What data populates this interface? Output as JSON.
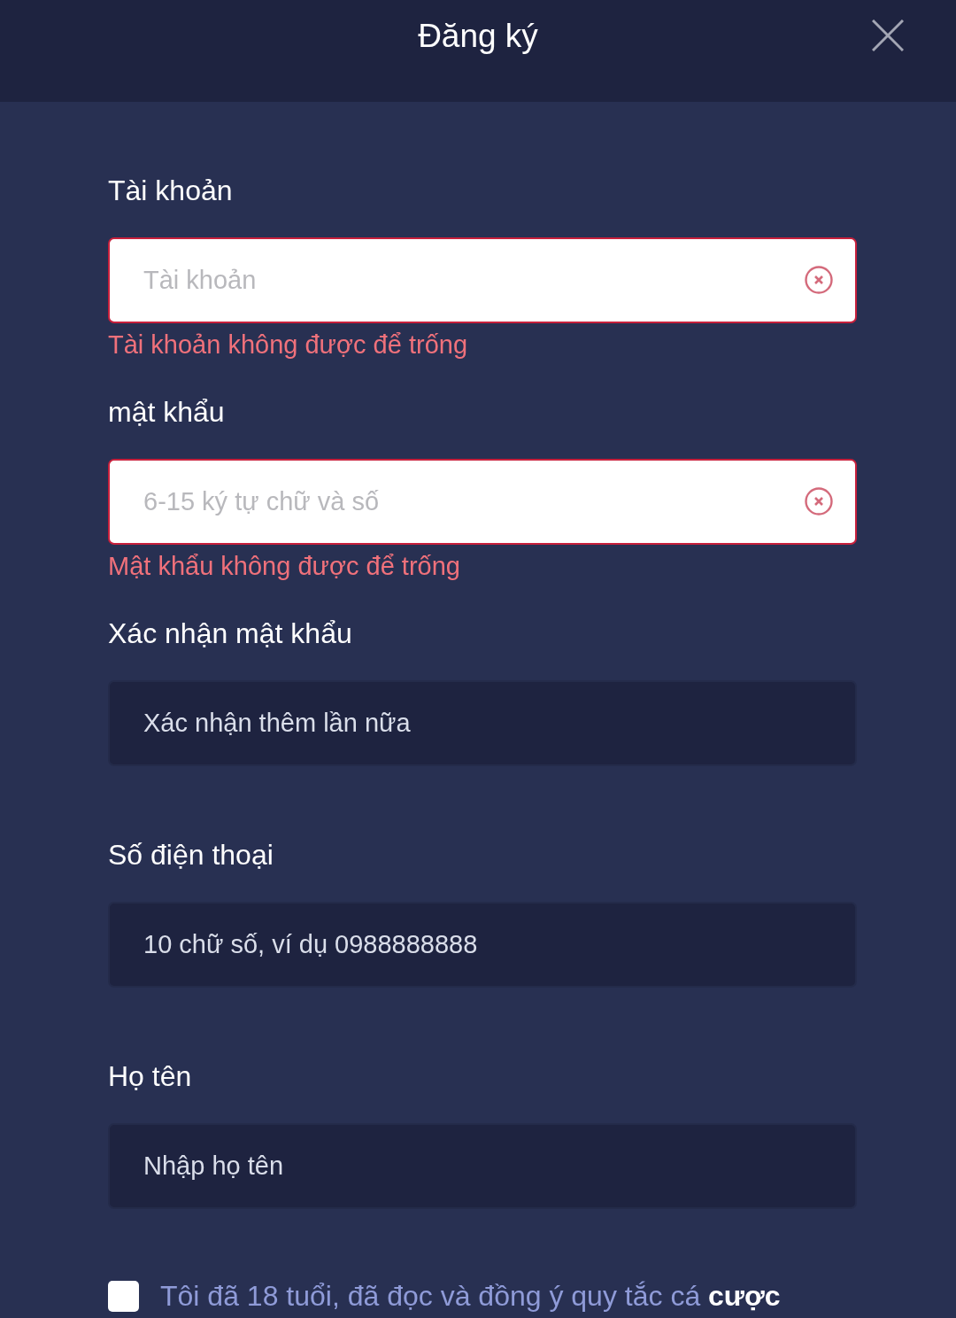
{
  "header": {
    "title": "Đăng ký"
  },
  "fields": [
    {
      "label": "Tài khoản",
      "placeholder": "Tài khoản",
      "invalid": true,
      "error": "Tài khoản không được để trống"
    },
    {
      "label": "mật khẩu",
      "placeholder": "6-15 ký tự chữ và số",
      "invalid": true,
      "error": "Mật khẩu không được để trống"
    },
    {
      "label": "Xác nhận mật khẩu",
      "placeholder": "Xác nhận thêm lần nữa",
      "invalid": false
    },
    {
      "label": "Số điện thoại",
      "placeholder": "10 chữ số, ví dụ 0988888888",
      "invalid": false
    },
    {
      "label": "Họ tên",
      "placeholder": "Nhập họ tên",
      "invalid": false
    }
  ],
  "agreement": {
    "checked": false,
    "text": "Tôi đã 18 tuổi, đã đọc và đồng ý quy tắc cá **cược**"
  }
}
